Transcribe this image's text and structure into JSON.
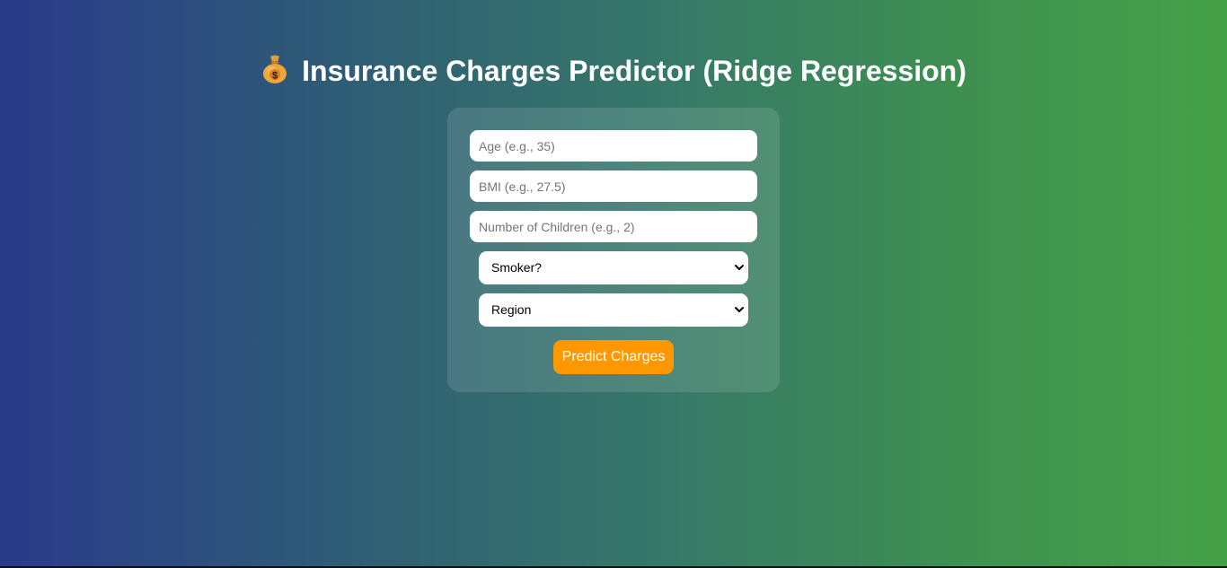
{
  "page": {
    "title_icon": "money-bag-icon",
    "title": "Insurance Charges Predictor (Ridge Regression)"
  },
  "form": {
    "age": {
      "placeholder": "Age (e.g., 35)",
      "value": ""
    },
    "bmi": {
      "placeholder": "BMI (e.g., 27.5)",
      "value": ""
    },
    "children": {
      "placeholder": "Number of Children (e.g., 2)",
      "value": ""
    },
    "smoker": {
      "selected": "Smoker?"
    },
    "region": {
      "selected": "Region"
    },
    "submit_label": "Predict Charges"
  },
  "colors": {
    "gradient_start": "#2a3a8a",
    "gradient_end": "#45a148",
    "button": "#ff9800",
    "text": "#ffffff"
  }
}
